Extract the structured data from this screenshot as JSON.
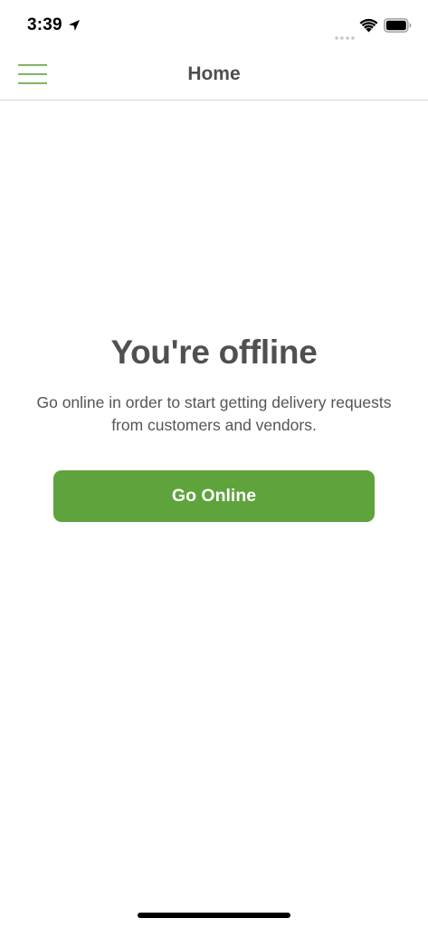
{
  "status_bar": {
    "time": "3:39",
    "icons": [
      "location-arrow-icon",
      "cellular-signal-icon",
      "wifi-icon",
      "battery-icon"
    ]
  },
  "nav": {
    "title": "Home",
    "menu_icon": "hamburger-menu-icon",
    "accent_color": "#5ea33b"
  },
  "main": {
    "headline": "You're offline",
    "description": "Go online in order to start getting delivery requests from customers and vendors.",
    "button_label": "Go Online",
    "button_color": "#5ea33b"
  }
}
